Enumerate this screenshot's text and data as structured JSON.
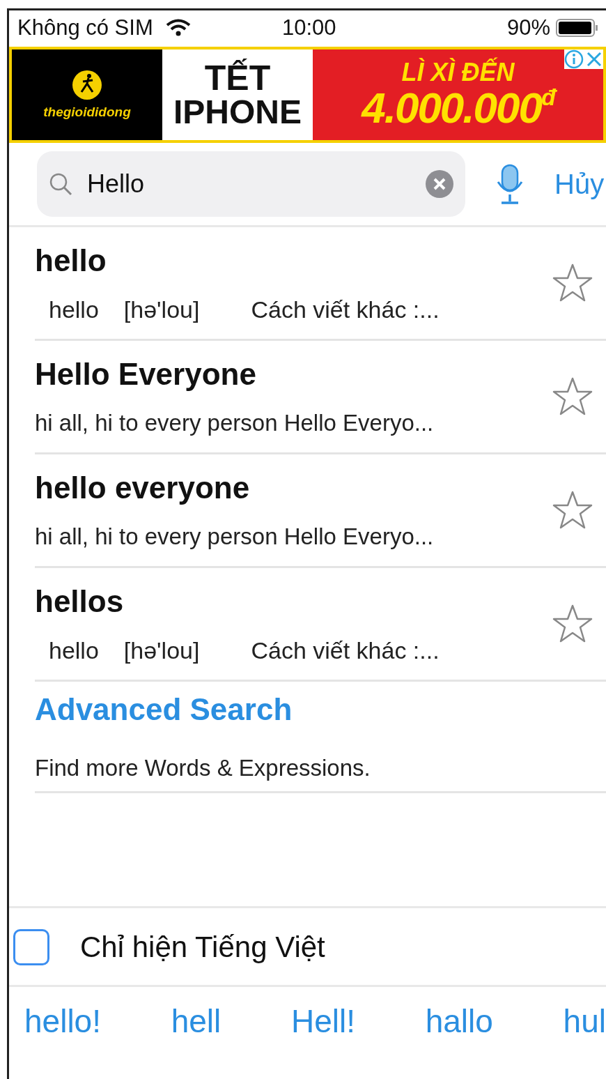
{
  "status_bar": {
    "carrier": "Không có SIM",
    "time": "10:00",
    "battery": "90%"
  },
  "ad_banner": {
    "brand": "thegioididong",
    "headline_1": "TẾT",
    "headline_2": "IPHONE",
    "offer_1": "LÌ XÌ ĐẾN",
    "offer_2": "4.000.000",
    "currency": "đ"
  },
  "search": {
    "value": "Hello",
    "cancel": "Hủy"
  },
  "results": [
    {
      "kind": "word",
      "title": "hello",
      "word": "hello",
      "pronunciation": "[hə'lou]",
      "note": "Cách viết khác :...",
      "favorited": false
    },
    {
      "kind": "phrase",
      "title": "Hello Everyone",
      "definition": "hi all, hi to every person Hello Everyo...",
      "favorited": false
    },
    {
      "kind": "phrase",
      "title": "hello everyone",
      "definition": "hi all, hi to every person Hello Everyo...",
      "favorited": false
    },
    {
      "kind": "word",
      "title": "hellos",
      "word": "hello",
      "pronunciation": "[hə'lou]",
      "note": "Cách viết khác :...",
      "favorited": false
    }
  ],
  "advanced_search": {
    "title": "Advanced Search",
    "subtitle": "Find more Words & Expressions."
  },
  "filter": {
    "label": "Chỉ hiện Tiếng Việt",
    "checked": false
  },
  "suggestions": [
    "hello!",
    "hell",
    "Hell!",
    "hallo",
    "hul"
  ]
}
